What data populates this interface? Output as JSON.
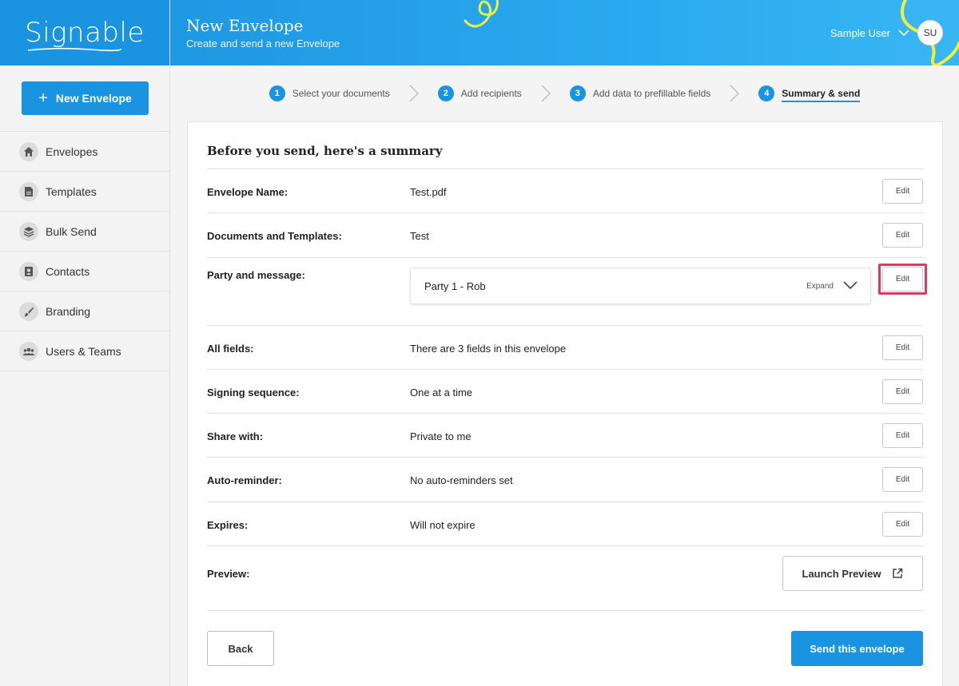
{
  "app": {
    "logo_text": "Signable"
  },
  "sidebar": {
    "new_envelope_label": "New Envelope",
    "items": [
      {
        "label": "Envelopes",
        "icon": "home-icon"
      },
      {
        "label": "Templates",
        "icon": "document-icon"
      },
      {
        "label": "Bulk Send",
        "icon": "layers-icon"
      },
      {
        "label": "Contacts",
        "icon": "contact-card-icon"
      },
      {
        "label": "Branding",
        "icon": "brush-icon"
      },
      {
        "label": "Users & Teams",
        "icon": "users-icon"
      }
    ]
  },
  "header": {
    "title": "New Envelope",
    "subtitle": "Create and send a new Envelope",
    "user_name": "Sample User",
    "avatar_initials": "SU"
  },
  "steps": [
    {
      "number": "1",
      "label": "Select your documents"
    },
    {
      "number": "2",
      "label": "Add recipients"
    },
    {
      "number": "3",
      "label": "Add data to prefillable fields"
    },
    {
      "number": "4",
      "label": "Summary & send",
      "active": true
    }
  ],
  "summary": {
    "title": "Before you send, here's a summary",
    "edit_label": "Edit",
    "rows": {
      "envelope_name": {
        "label": "Envelope Name:",
        "value": "Test.pdf"
      },
      "documents": {
        "label": "Documents and Templates:",
        "value": "Test"
      },
      "party": {
        "label": "Party and message:",
        "party_name": "Party 1 - Rob",
        "expand_label": "Expand"
      },
      "all_fields": {
        "label": "All fields:",
        "value": "There are 3 fields in this envelope"
      },
      "signing_sequence": {
        "label": "Signing sequence:",
        "value": "One at a time"
      },
      "share_with": {
        "label": "Share with:",
        "value": "Private to me"
      },
      "auto_reminder": {
        "label": "Auto-reminder:",
        "value": "No auto-reminders set"
      },
      "expires": {
        "label": "Expires:",
        "value": "Will not expire"
      },
      "preview": {
        "label": "Preview:",
        "button_label": "Launch Preview"
      }
    },
    "back_label": "Back",
    "send_label": "Send this envelope"
  },
  "colors": {
    "accent": "#1a94e0",
    "highlight": "#d63b62",
    "deco_yellow": "#f2ee3a"
  }
}
